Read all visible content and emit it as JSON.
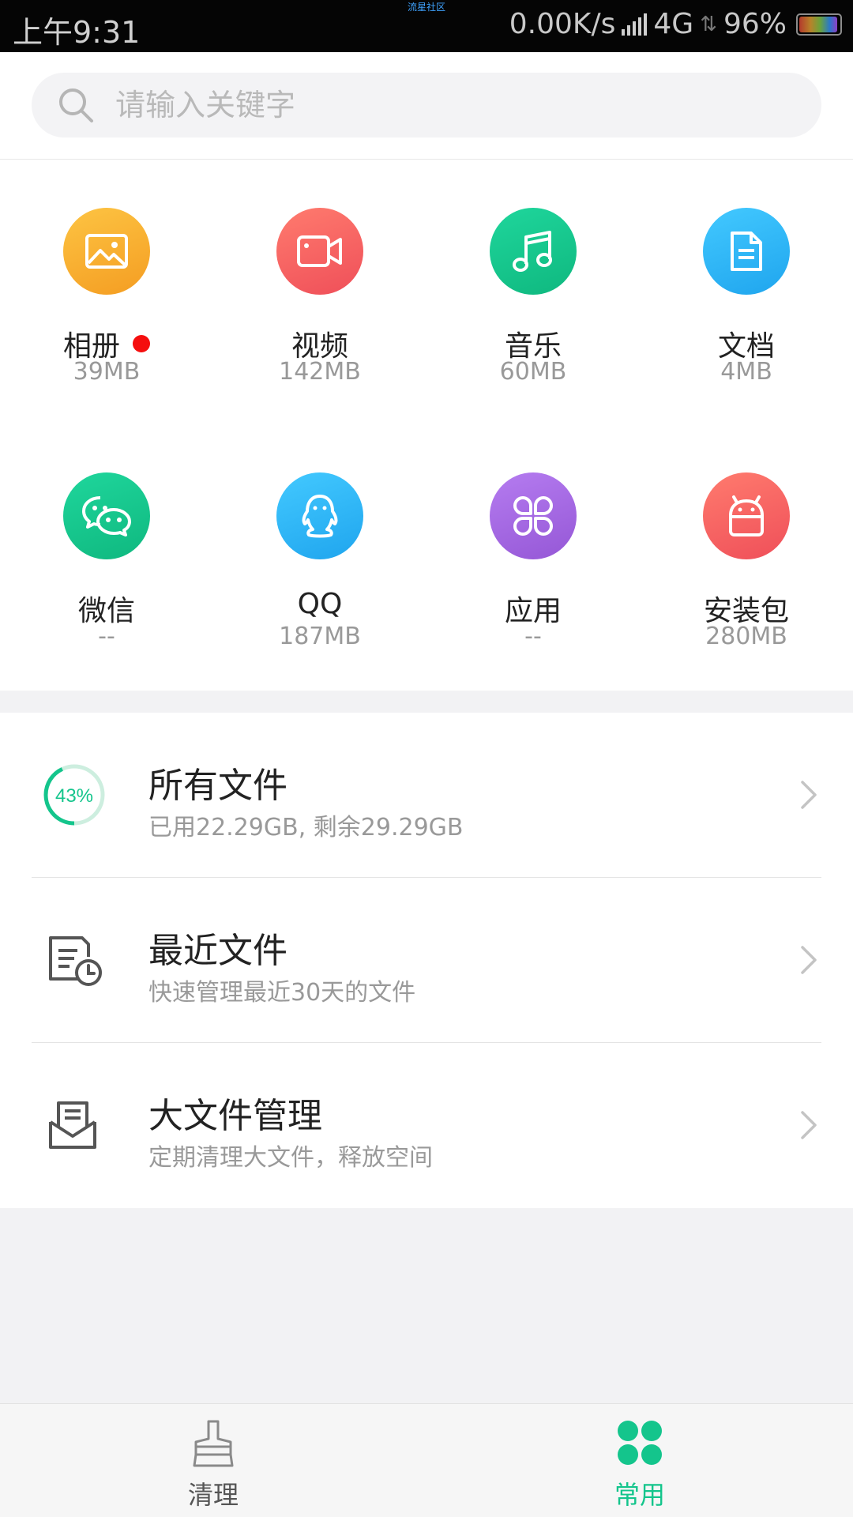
{
  "status_bar": {
    "time": "上午9:31",
    "center_text": "流星社区",
    "net_speed": "0.00K/s",
    "network": "4G",
    "battery": "96%"
  },
  "search": {
    "placeholder": "请输入关键字"
  },
  "categories": [
    {
      "name": "相册",
      "size": "39MB",
      "icon": "photo-icon",
      "color": "#f9ad2e",
      "has_dot": true
    },
    {
      "name": "视频",
      "size": "142MB",
      "icon": "video-icon",
      "color": "#f25d5d"
    },
    {
      "name": "音乐",
      "size": "60MB",
      "icon": "music-icon",
      "color": "#14c58c"
    },
    {
      "name": "文档",
      "size": "4MB",
      "icon": "document-icon",
      "color": "#2cb6f2"
    },
    {
      "name": "微信",
      "size": "--",
      "icon": "wechat-icon",
      "color": "#14c58c"
    },
    {
      "name": "QQ",
      "size": "187MB",
      "icon": "qq-icon",
      "color": "#2cb6f2"
    },
    {
      "name": "应用",
      "size": "--",
      "icon": "apps-icon",
      "color": "#a366e0"
    },
    {
      "name": "安装包",
      "size": "280MB",
      "icon": "android-icon",
      "color": "#f25d5d"
    }
  ],
  "list": [
    {
      "title": "所有文件",
      "subtitle": "已用22.29GB, 剩余29.29GB",
      "icon": "storage-progress-icon",
      "progress_label": "43%",
      "progress": 0.43
    },
    {
      "title": "最近文件",
      "subtitle": "快速管理最近30天的文件",
      "icon": "recent-files-icon"
    },
    {
      "title": "大文件管理",
      "subtitle": "定期清理大文件，释放空间",
      "icon": "large-files-icon"
    }
  ],
  "bottom_nav": [
    {
      "label": "清理",
      "icon": "broom-icon",
      "active": false
    },
    {
      "label": "常用",
      "icon": "common-grid-icon",
      "active": true
    }
  ],
  "colors": {
    "accent": "#14c58c",
    "inactive": "#555555"
  }
}
